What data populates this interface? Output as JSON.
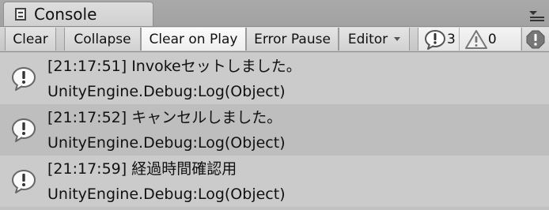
{
  "tab": {
    "title": "Console",
    "icon": "console-icon"
  },
  "panel_menu": {
    "icon": "panel-menu-icon"
  },
  "toolbar": {
    "clear_label": "Clear",
    "collapse_label": "Collapse",
    "clear_on_play_label": "Clear on Play",
    "error_pause_label": "Error Pause",
    "editor_label": "Editor",
    "log_count": "3",
    "warning_count": "0",
    "clear_on_play_active": true
  },
  "logs": [
    {
      "time": "[21:17:51]",
      "message": "Invokeセットしました。",
      "line1": "[21:17:51] Invokeセットしました。",
      "line2": "UnityEngine.Debug:Log(Object)",
      "icon": "info-icon"
    },
    {
      "time": "[21:17:52]",
      "message": "キャンセルしました。",
      "line1": "[21:17:52] キャンセルしました。",
      "line2": "UnityEngine.Debug:Log(Object)",
      "icon": "info-icon"
    },
    {
      "time": "[21:17:59]",
      "message": "経過時間確認用",
      "line1": "[21:17:59] 経過時間確認用",
      "line2": "UnityEngine.Debug:Log(Object)",
      "icon": "info-icon"
    }
  ],
  "colors": {
    "row_even": "#cbcbcb",
    "row_odd": "#bebebe",
    "active_button": "#f4f4f4"
  }
}
